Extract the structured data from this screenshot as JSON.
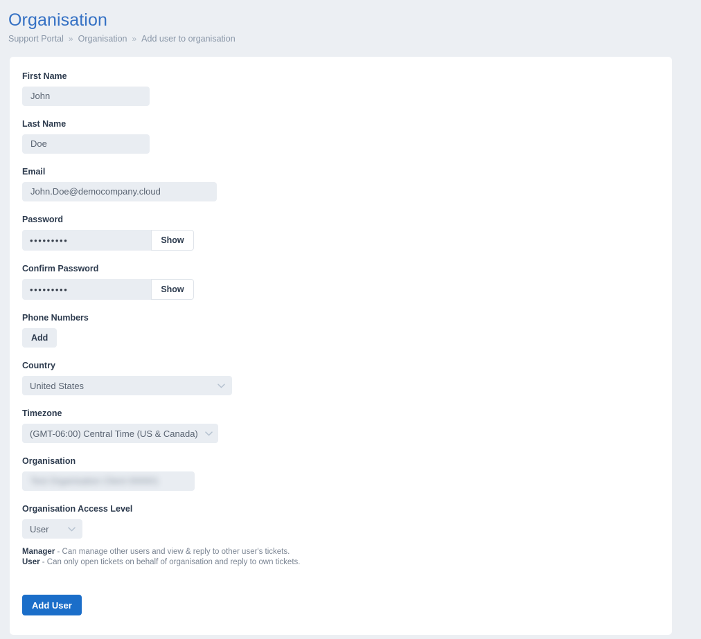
{
  "header": {
    "title": "Organisation",
    "breadcrumb": [
      {
        "label": "Support Portal"
      },
      {
        "label": "Organisation"
      },
      {
        "label": "Add user to organisation"
      }
    ],
    "separator": "»"
  },
  "form": {
    "first_name": {
      "label": "First Name",
      "value": "John",
      "placeholder": "First Name"
    },
    "last_name": {
      "label": "Last Name",
      "value": "Doe",
      "placeholder": "Last Name"
    },
    "email": {
      "label": "Email",
      "value": "John.Doe@democompany.cloud",
      "placeholder": "Email"
    },
    "password": {
      "label": "Password",
      "value": "•••••••••",
      "toggle_label": "Show"
    },
    "confirm_password": {
      "label": "Confirm Password",
      "value": "•••••••••",
      "toggle_label": "Show"
    },
    "phone_numbers": {
      "label": "Phone Numbers",
      "add_label": "Add"
    },
    "country": {
      "label": "Country",
      "value": "United States"
    },
    "timezone": {
      "label": "Timezone",
      "value": "(GMT-06:00) Central Time (US & Canada)"
    },
    "organisation": {
      "label": "Organisation",
      "value": "Test Organisation Client 000001",
      "redacted": true
    },
    "access_level": {
      "label": "Organisation Access Level",
      "value": "User",
      "notes": [
        {
          "role": "Manager",
          "text": " - Can manage other users and view & reply to other user's tickets."
        },
        {
          "role": "User",
          "text": " - Can only open tickets on behalf of organisation and reply to own tickets."
        }
      ]
    },
    "submit": {
      "label": "Add User"
    }
  },
  "colors": {
    "page_background": "#eceff3",
    "card_background": "#ffffff",
    "title_blue": "#3571c4",
    "primary_button": "#1b6ec9",
    "input_background": "#e9edf2",
    "label_text": "#2d3b4e",
    "muted_text": "#8a97a8"
  }
}
